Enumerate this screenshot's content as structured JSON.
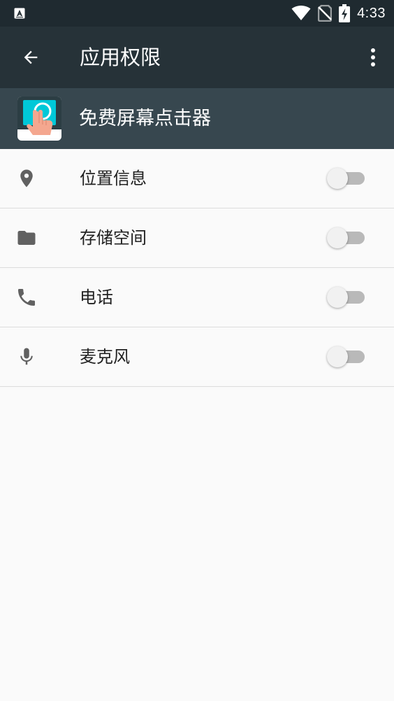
{
  "status_bar": {
    "time": "4:33",
    "left_icon": "a-notification-icon",
    "icons": [
      "wifi-icon",
      "no-sim-icon",
      "battery-charging-icon"
    ]
  },
  "toolbar": {
    "title": "应用权限",
    "back_icon": "back-arrow-icon",
    "more_icon": "more-vert-icon"
  },
  "app": {
    "name": "免费屏幕点击器",
    "icon": "tap-screen-app-icon"
  },
  "permissions": [
    {
      "label": "位置信息",
      "icon": "location-icon",
      "enabled": false
    },
    {
      "label": "存储空间",
      "icon": "folder-icon",
      "enabled": false
    },
    {
      "label": "电话",
      "icon": "phone-icon",
      "enabled": false
    },
    {
      "label": "麦克风",
      "icon": "microphone-icon",
      "enabled": false
    }
  ],
  "colors": {
    "status_bar": "#1f2a30",
    "toolbar": "#263238",
    "app_header": "#37474f",
    "background": "#fafafa",
    "icon_grey": "#616161",
    "app_icon_cyan": "#00c8d8"
  }
}
